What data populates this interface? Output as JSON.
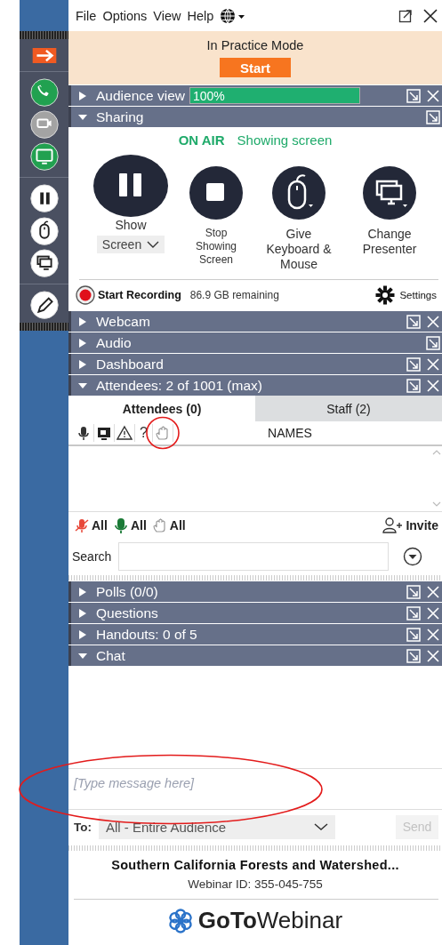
{
  "menu": [
    {
      "label": "File"
    },
    {
      "label": "Options"
    },
    {
      "label": "View"
    },
    {
      "label": "Help"
    }
  ],
  "practice": {
    "status": "In Practice Mode",
    "button": "Start"
  },
  "sidebar": [
    {
      "kind": "arrow",
      "color": "#f05a22"
    },
    {
      "kind": "phone",
      "color": "#21a150"
    },
    {
      "kind": "webcam",
      "color": "#a3a3a3"
    },
    {
      "kind": "screen",
      "color": "#21a150"
    },
    {
      "kind": "pause",
      "color": "#ffffff"
    },
    {
      "kind": "mouse",
      "color": "#ffffff"
    },
    {
      "kind": "presenter",
      "color": "#ffffff"
    },
    {
      "kind": "pencil",
      "color": "#ffffff"
    }
  ],
  "panels": [
    {
      "kind": "audience",
      "title": "Audience view",
      "expanded": false,
      "closable": true,
      "level": 1,
      "reading": "100%"
    },
    {
      "kind": "sharing",
      "title": "Sharing",
      "expanded": true,
      "closable": false
    },
    {
      "kind": "webcam",
      "title": "Webcam",
      "expanded": false,
      "closable": true
    },
    {
      "kind": "audio",
      "title": "Audio",
      "expanded": false,
      "closable": false
    },
    {
      "kind": "dashboard",
      "title": "Dashboard",
      "expanded": false,
      "closable": true
    },
    {
      "kind": "attendees",
      "title": "Attendees:  2 of 1001 (max)",
      "expanded": true,
      "closable": true
    },
    {
      "kind": "polls",
      "title": "Polls (0/0)",
      "expanded": false,
      "closable": true
    },
    {
      "kind": "questions",
      "title": "Questions",
      "expanded": false,
      "closable": true
    },
    {
      "kind": "handouts",
      "title": "Handouts: 0 of 5",
      "expanded": false,
      "closable": true
    },
    {
      "kind": "chat",
      "title": "Chat",
      "expanded": true,
      "closable": true
    }
  ],
  "sharing": {
    "on_air": "ON AIR",
    "status": "Showing screen",
    "actions": [
      {
        "kind": "pause",
        "label": "Show",
        "dropdown": "Screen"
      },
      {
        "kind": "stop",
        "label": "Stop Showing Screen"
      },
      {
        "kind": "mouse",
        "label": "Give Keyboard & Mouse"
      },
      {
        "kind": "presenter",
        "label": "Change Presenter"
      }
    ],
    "recording": {
      "label": "Start Recording",
      "remaining": "86.9 GB remaining",
      "settings": "Settings"
    }
  },
  "attendees": {
    "tabs": [
      {
        "label": "Attendees (0)",
        "selected": true
      },
      {
        "label": "Staff (2)",
        "selected": false
      }
    ],
    "columns": [
      {
        "kind": "mic",
        "circled": false
      },
      {
        "kind": "screen",
        "circled": false
      },
      {
        "kind": "warning",
        "circled": false
      },
      {
        "kind": "text",
        "label": "?",
        "circled": false
      },
      {
        "kind": "hand",
        "circled": true
      },
      {
        "kind": "names",
        "label": "NAMES",
        "circled": false
      }
    ],
    "actions": [
      {
        "kind": "mute",
        "label": "All"
      },
      {
        "kind": "unmute",
        "label": "All"
      },
      {
        "kind": "lower-hand",
        "label": "All"
      }
    ],
    "invite": "Invite",
    "search_label": "Search"
  },
  "chat": {
    "placeholder": "[Type message here]",
    "circled": true,
    "to_label": "To:",
    "recipient": "All - Entire Audience",
    "send": "Send",
    "send_disabled": true
  },
  "footer": {
    "title": "Southern California Forests and Watershed...",
    "webinar_id": "Webinar ID: 355-045-755",
    "brand": "**GoTo**Webinar"
  }
}
